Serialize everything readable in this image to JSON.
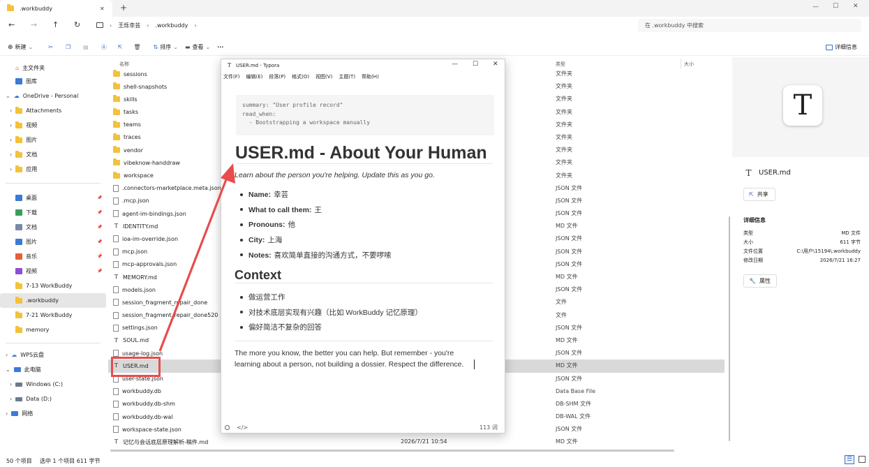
{
  "tabbar": {
    "tab_title": ".workbuddy",
    "new_tab": "+",
    "minimize": "—",
    "maximize": "☐",
    "close": "✕"
  },
  "nav": {
    "back": "←",
    "forward": "→",
    "up": "↑",
    "refresh": "↻",
    "breadcrumb": [
      "王烁幸芸",
      ".workbuddy"
    ],
    "search_placeholder": "在 .workbuddy 中搜索"
  },
  "commands": {
    "new": "新建",
    "sort": "排序",
    "view": "查看",
    "more": "···",
    "details": "详细信息"
  },
  "sidebar": {
    "quick": [
      {
        "label": "主文件夹",
        "icon": "home-icon"
      },
      {
        "label": "图库",
        "icon": "gallery-icon"
      }
    ],
    "onedrive": {
      "label": "OneDrive - Personal",
      "children": [
        "Attachments",
        "视频",
        "图片",
        "文档",
        "应用"
      ]
    },
    "pinned": [
      {
        "label": "桌面",
        "icon": "desktop-icon",
        "color": "#3a7bd5"
      },
      {
        "label": "下载",
        "icon": "download-icon",
        "color": "#3a9d5d"
      },
      {
        "label": "文档",
        "icon": "document-icon",
        "color": "#7a8aa6"
      },
      {
        "label": "图片",
        "icon": "picture-icon",
        "color": "#3a7bd5"
      },
      {
        "label": "音乐",
        "icon": "music-icon",
        "color": "#e5603a"
      },
      {
        "label": "视频",
        "icon": "video-icon",
        "color": "#8a4fd8"
      },
      {
        "label": "7-13 WorkBuddy",
        "icon": "folder-icon"
      },
      {
        "label": ".workbuddy",
        "icon": "folder-icon"
      },
      {
        "label": "7-21 WorkBuddy",
        "icon": "folder-icon"
      },
      {
        "label": "memory",
        "icon": "folder-icon"
      }
    ],
    "bottom": [
      {
        "label": "WPS云盘",
        "icon": "cloud-icon"
      },
      {
        "label": "此电脑",
        "icon": "pc-icon"
      },
      {
        "label": "Windows (C:)",
        "icon": "drive-icon"
      },
      {
        "label": "Data (D:)",
        "icon": "drive-icon"
      },
      {
        "label": "网络",
        "icon": "network-icon"
      }
    ]
  },
  "columns": {
    "name": "名称",
    "type": "类型",
    "size": "大小"
  },
  "files": [
    {
      "name": "sessions",
      "icon": "folder",
      "type": "文件夹"
    },
    {
      "name": "shell-snapshots",
      "icon": "folder",
      "type": "文件夹"
    },
    {
      "name": "skills",
      "icon": "folder",
      "type": "文件夹"
    },
    {
      "name": "tasks",
      "icon": "folder",
      "type": "文件夹"
    },
    {
      "name": "teams",
      "icon": "folder",
      "type": "文件夹"
    },
    {
      "name": "traces",
      "icon": "folder",
      "type": "文件夹"
    },
    {
      "name": "vendor",
      "icon": "folder",
      "type": "文件夹"
    },
    {
      "name": "vibeknow-handdraw",
      "icon": "folder",
      "type": "文件夹"
    },
    {
      "name": "workspace",
      "icon": "folder",
      "type": "文件夹"
    },
    {
      "name": ".connectors-marketplace.meta.json",
      "icon": "file",
      "type": "JSON 文件"
    },
    {
      "name": ".mcp.json",
      "icon": "file",
      "type": "JSON 文件"
    },
    {
      "name": "agent-im-bindings.json",
      "icon": "file",
      "type": "JSON 文件"
    },
    {
      "name": "IDENTITY.md",
      "icon": "md",
      "type": "MD 文件"
    },
    {
      "name": "ioa-im-override.json",
      "icon": "file",
      "type": "JSON 文件"
    },
    {
      "name": "mcp.json",
      "icon": "file",
      "type": "JSON 文件"
    },
    {
      "name": "mcp-approvals.json",
      "icon": "file",
      "type": "JSON 文件"
    },
    {
      "name": "MEMORY.md",
      "icon": "md",
      "type": "MD 文件"
    },
    {
      "name": "models.json",
      "icon": "file",
      "type": "JSON 文件"
    },
    {
      "name": "session_fragment_repair_done",
      "icon": "file",
      "type": "文件"
    },
    {
      "name": "session_fragment_repair_done520",
      "icon": "file",
      "type": "文件"
    },
    {
      "name": "settings.json",
      "icon": "file",
      "type": "JSON 文件"
    },
    {
      "name": "SOUL.md",
      "icon": "md",
      "type": "MD 文件"
    },
    {
      "name": "usage-log.json",
      "icon": "file",
      "type": "JSON 文件"
    },
    {
      "name": "USER.md",
      "icon": "md",
      "type": "MD 文件",
      "selected": true
    },
    {
      "name": "user-state.json",
      "icon": "file",
      "type": "JSON 文件"
    },
    {
      "name": "workbuddy.db",
      "icon": "file",
      "type": "Data Base File"
    },
    {
      "name": "workbuddy.db-shm",
      "icon": "file",
      "type": "DB-SHM 文件"
    },
    {
      "name": "workbuddy.db-wal",
      "icon": "file",
      "type": "DB-WAL 文件"
    },
    {
      "name": "workspace-state.json",
      "icon": "file",
      "type": "JSON 文件"
    },
    {
      "name": "记忆与会话底层原理解析-稿件.md",
      "icon": "md",
      "type": "MD 文件",
      "date": "2026/7/21 10:54"
    }
  ],
  "details": {
    "filename": "USER.md",
    "share": "共享",
    "section_title": "详细信息",
    "props": [
      {
        "k": "类型",
        "v": "MD 文件"
      },
      {
        "k": "大小",
        "v": "611 字节"
      },
      {
        "k": "文件位置",
        "v": "C:\\用户\\15194\\.workbuddy"
      },
      {
        "k": "修改日期",
        "v": "2026/7/21 16:27"
      }
    ],
    "properties_btn": "属性"
  },
  "typora": {
    "title": "USER.md - Typora",
    "menu": [
      "文件(F)",
      "编辑(E)",
      "段落(P)",
      "格式(O)",
      "视图(V)",
      "主题(T)",
      "帮助(H)"
    ],
    "frontmatter": "summary: \"User profile record\"\nread_when:\n  - Bootstrapping a workspace manually",
    "h1": "USER.md - About Your Human",
    "intro": "Learn about the person you're helping. Update this as you go.",
    "fields": [
      {
        "k": "Name:",
        "v": "幸芸"
      },
      {
        "k": "What to call them:",
        "v": "王"
      },
      {
        "k": "Pronouns:",
        "v": "他"
      },
      {
        "k": "City:",
        "v": "上海"
      },
      {
        "k": "Notes:",
        "v": "喜欢简单直接的沟通方式，不要啰嗦"
      }
    ],
    "h2": "Context",
    "context": [
      "做运营工作",
      "对技术底层实现有兴趣（比如 WorkBuddy 记忆原理）",
      "偏好简洁不复杂的回答"
    ],
    "closing_line1": "The more you know, the better you can help. But remember - you're",
    "closing_line2": "learning about a person, not building a dossier. Respect the difference.",
    "word_count": "113 词"
  },
  "status": {
    "count": "50 个项目",
    "selected": "选中 1 个项目  611 字节"
  },
  "colors": {
    "annotation": "#e84c4c",
    "folder": "#f3c23b",
    "selection": "#d9d9d9"
  }
}
